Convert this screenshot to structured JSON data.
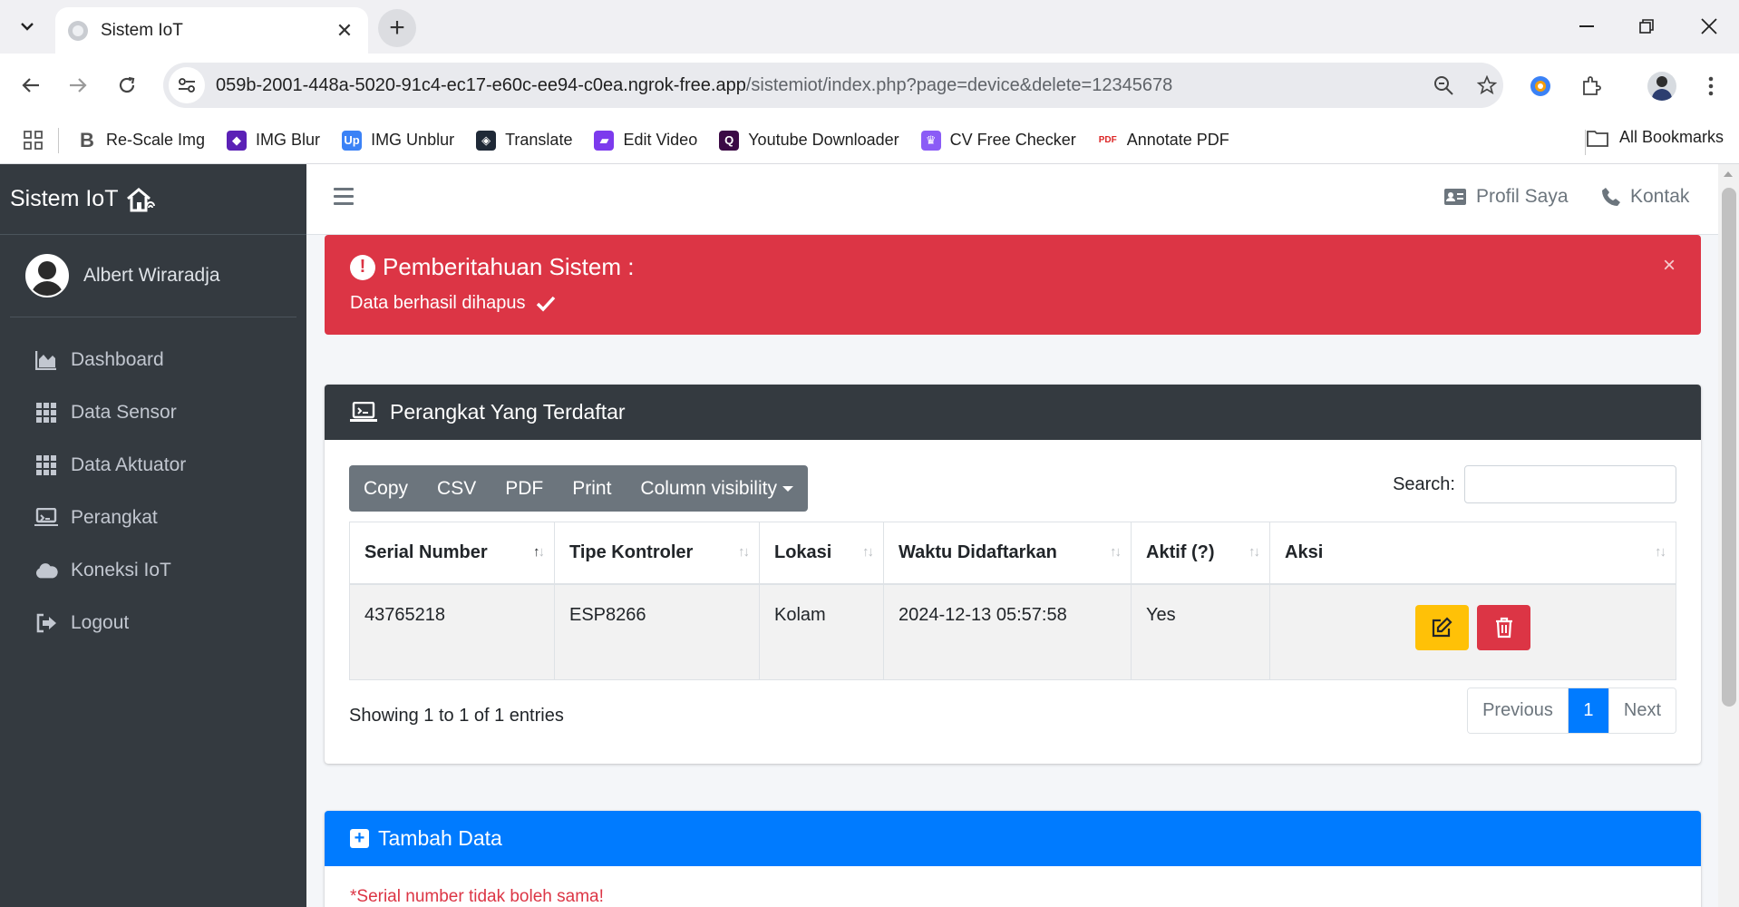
{
  "browser": {
    "tab_title": "Sistem IoT",
    "url_host": "059b-2001-448a-5020-91c4-ec17-e60c-ee94-c0ea.ngrok-free.app",
    "url_path": "/sistemiot/index.php?page=device&delete=12345678",
    "bookmarks": [
      {
        "label": "Re-Scale Img",
        "icon": "rescale-icon",
        "color": "#444444"
      },
      {
        "label": "IMG Blur",
        "icon": "img-blur-icon",
        "color": "#5b21b6"
      },
      {
        "label": "IMG Unblur",
        "icon": "img-unblur-icon",
        "color": "#3b82f6"
      },
      {
        "label": "Translate",
        "icon": "translate-icon",
        "color": "#1f2937"
      },
      {
        "label": "Edit Video",
        "icon": "edit-video-icon",
        "color": "#7c3aed"
      },
      {
        "label": "Youtube Downloader",
        "icon": "youtube-downloader-icon",
        "color": "#3b0a45"
      },
      {
        "label": "CV Free Checker",
        "icon": "cv-checker-icon",
        "color": "#8b5cf6"
      },
      {
        "label": "Annotate PDF",
        "icon": "pdf-icon",
        "color": "#dc2626"
      }
    ],
    "all_bookmarks_label": "All Bookmarks"
  },
  "sidebar": {
    "brand": "Sistem IoT",
    "user_name": "Albert Wiraradja",
    "menu": [
      {
        "label": "Dashboard",
        "icon": "chart-area-icon"
      },
      {
        "label": "Data Sensor",
        "icon": "grid-icon"
      },
      {
        "label": "Data Aktuator",
        "icon": "grid-icon"
      },
      {
        "label": "Perangkat",
        "icon": "laptop-icon"
      },
      {
        "label": "Koneksi IoT",
        "icon": "cloud-icon"
      },
      {
        "label": "Logout",
        "icon": "logout-icon"
      }
    ]
  },
  "topnav": {
    "profile": "Profil Saya",
    "contact": "Kontak"
  },
  "alert": {
    "title": "Pemberitahuan Sistem :",
    "message": "Data berhasil dihapus",
    "close": "×"
  },
  "devices_card": {
    "title": "Perangkat Yang Terdaftar",
    "buttons": [
      "Copy",
      "CSV",
      "PDF",
      "Print",
      "Column visibility"
    ],
    "search_label": "Search:",
    "search_value": "",
    "columns": [
      "Serial Number",
      "Tipe Kontroler",
      "Lokasi",
      "Waktu Didaftarkan",
      "Aktif (?)",
      "Aksi"
    ],
    "rows": [
      {
        "serial": "43765218",
        "type": "ESP8266",
        "location": "Kolam",
        "registered": "2024-12-13 05:57:58",
        "active": "Yes"
      }
    ],
    "info": "Showing 1 to 1 of 1 entries",
    "pagination": {
      "previous": "Previous",
      "current": "1",
      "next": "Next"
    }
  },
  "add_card": {
    "title": "Tambah Data",
    "note": "*Serial number tidak boleh sama!"
  },
  "colors": {
    "sidebar_bg": "#343a40",
    "danger": "#dc3545",
    "warning": "#ffc107",
    "primary": "#007bff",
    "secondary": "#6c757d"
  }
}
